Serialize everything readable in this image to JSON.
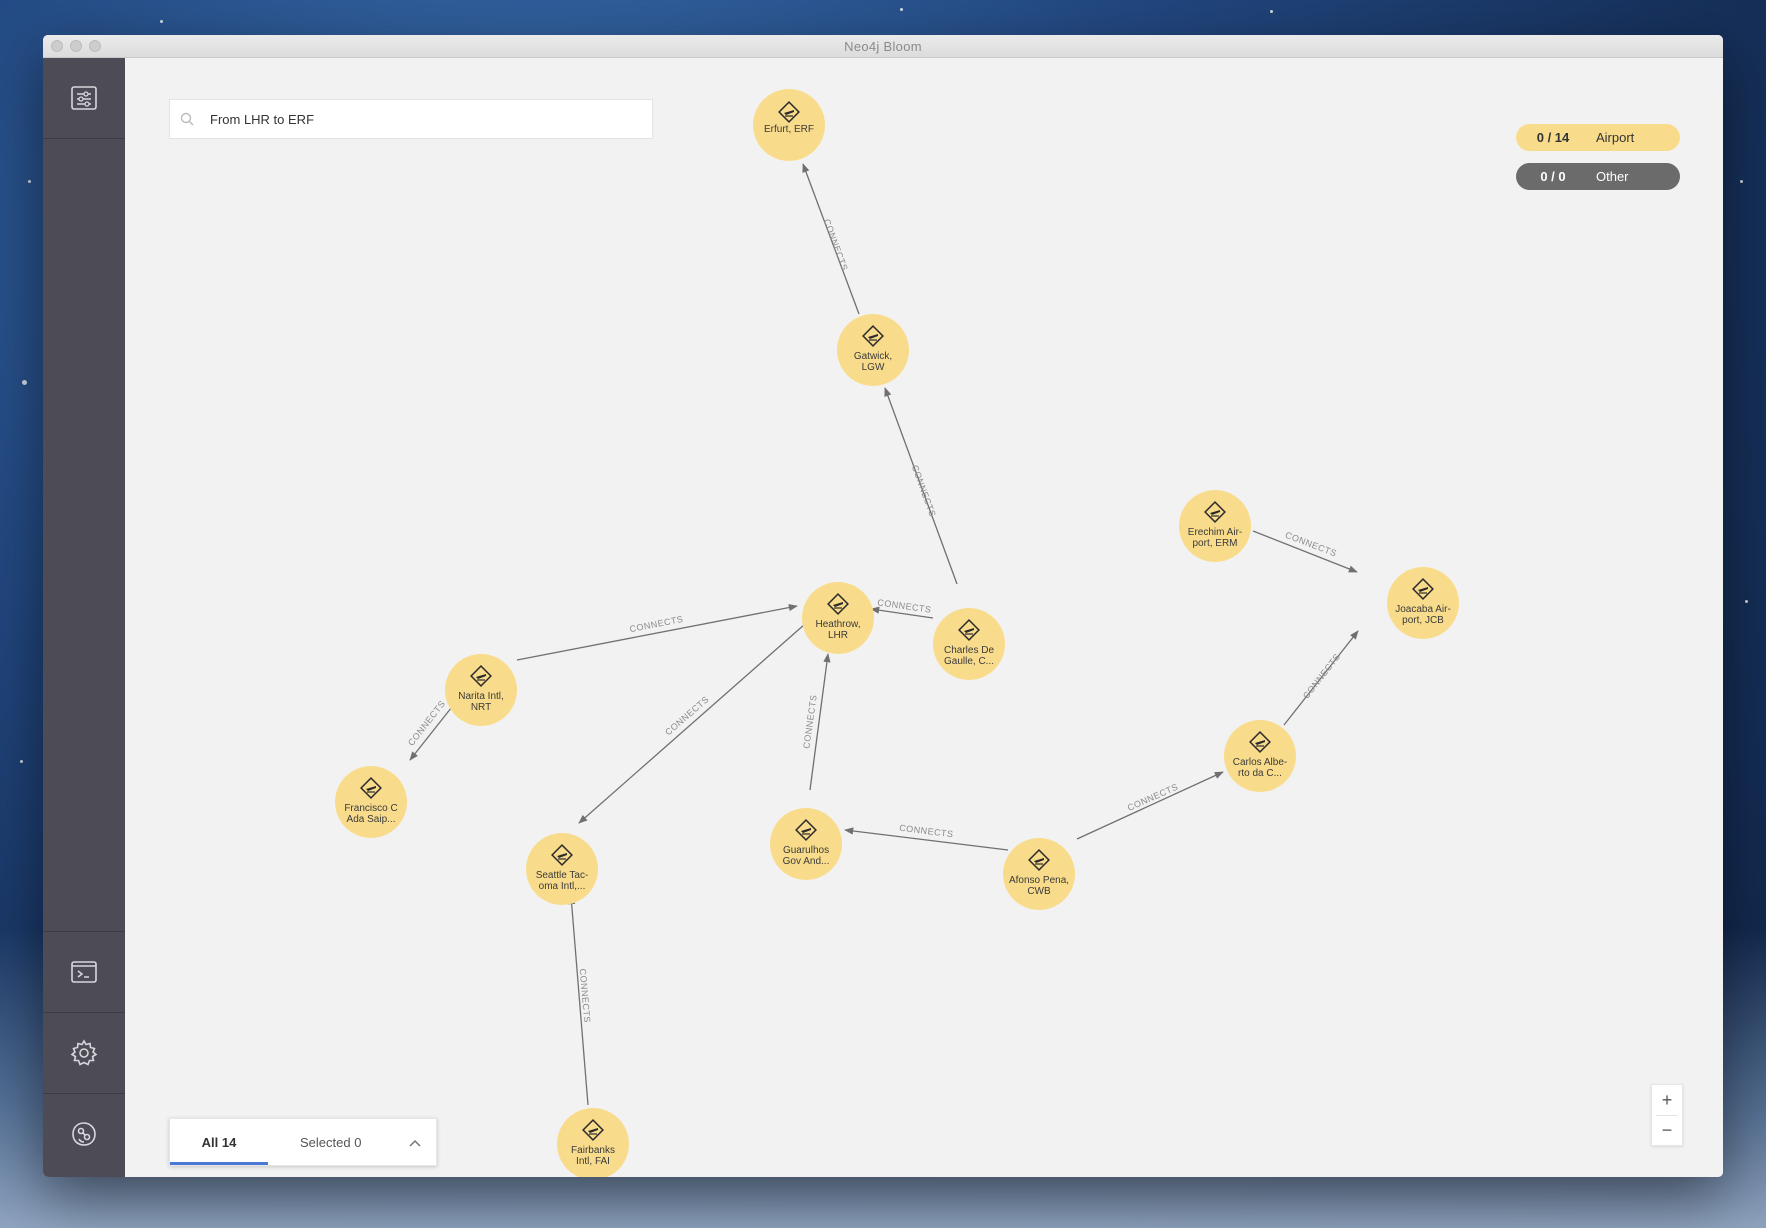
{
  "app": {
    "window_title": "Neo4j Bloom"
  },
  "sidebar": {
    "top": {
      "icon": "filter-settings-icon"
    },
    "bottom": [
      {
        "icon": "terminal-icon"
      },
      {
        "icon": "gear-icon"
      },
      {
        "icon": "neo4j-logo-icon"
      }
    ]
  },
  "search": {
    "value": "From LHR to ERF",
    "icon": "search-icon"
  },
  "legend": [
    {
      "count": "0 / 14",
      "label": "Airport",
      "color": "#f9dc8b"
    },
    {
      "count": "0 / 0",
      "label": "Other",
      "color": "#6b6b6b"
    }
  ],
  "graph": {
    "node_color": "#f9dc8b",
    "edge_label": "CONNECTS",
    "nodes": [
      {
        "id": "erf",
        "line1": "Erfurt, ERF",
        "line2": ""
      },
      {
        "id": "lgw",
        "line1": "Gatwick,",
        "line2": "LGW"
      },
      {
        "id": "lhr",
        "line1": "Heathrow,",
        "line2": "LHR"
      },
      {
        "id": "cdg",
        "line1": "Charles De",
        "line2": "Gaulle, C..."
      },
      {
        "id": "nrt",
        "line1": "Narita Intl,",
        "line2": "NRT"
      },
      {
        "id": "fcas",
        "line1": "Francisco C",
        "line2": "Ada Saip..."
      },
      {
        "id": "sea",
        "line1": "Seattle Tac-",
        "line2": "oma Intl,..."
      },
      {
        "id": "gru",
        "line1": "Guarulhos",
        "line2": "Gov And..."
      },
      {
        "id": "cwb",
        "line1": "Afonso Pena,",
        "line2": "CWB"
      },
      {
        "id": "cac",
        "line1": "Carlos Albe-",
        "line2": "rto da C..."
      },
      {
        "id": "jcb",
        "line1": "Joacaba Air-",
        "line2": "port, JCB"
      },
      {
        "id": "erm",
        "line1": "Erechim Air-",
        "line2": "port, ERM"
      },
      {
        "id": "fai",
        "line1": "Fairbanks",
        "line2": "Intl, FAI"
      }
    ]
  },
  "results_panel": {
    "tab_all": "All 14",
    "tab_selected": "Selected 0",
    "chevron": "chevron-up-icon"
  },
  "zoom": {
    "in": "+",
    "out": "−"
  }
}
